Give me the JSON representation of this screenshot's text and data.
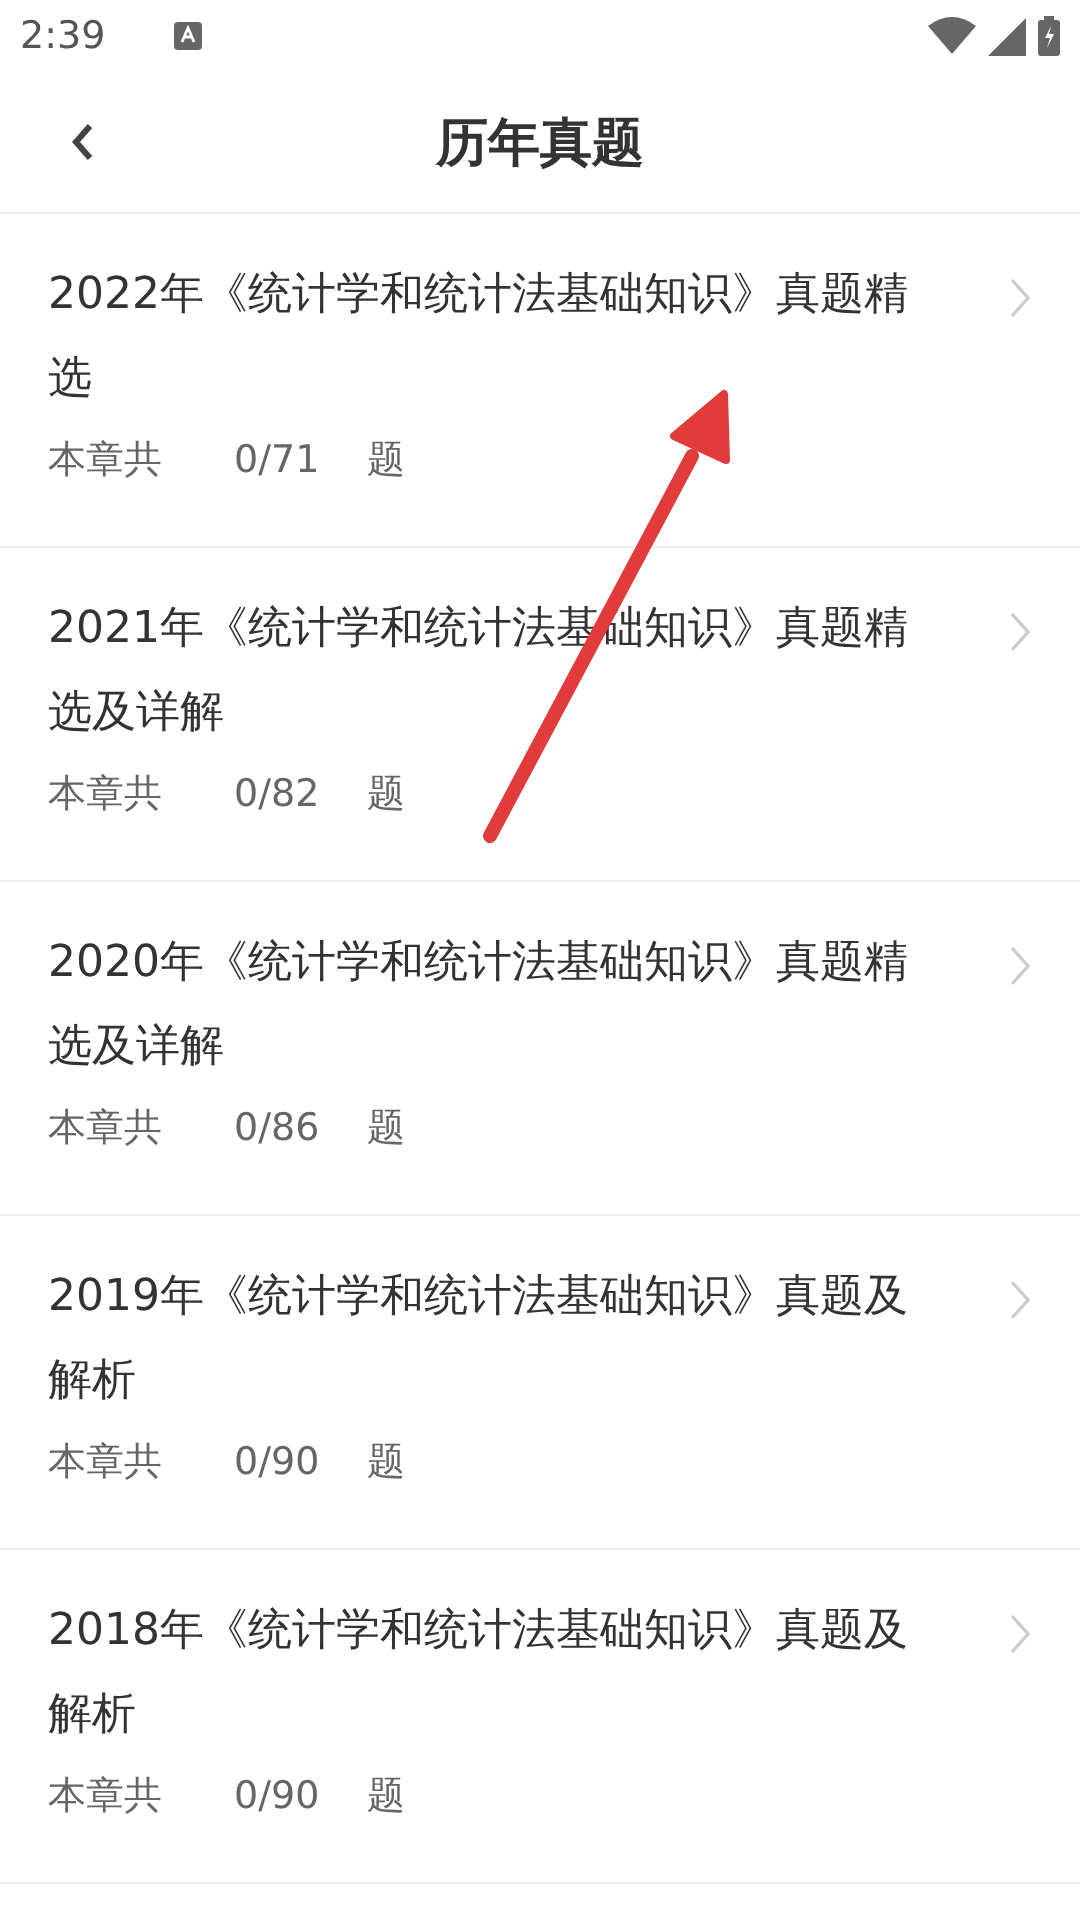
{
  "status_bar": {
    "time": "2:39"
  },
  "header": {
    "title": "历年真题"
  },
  "items": [
    {
      "title": "2022年《统计学和统计法基础知识》真题精选",
      "label": "本章共",
      "progress": "0/71",
      "unit": "题"
    },
    {
      "title": "2021年《统计学和统计法基础知识》真题精选及详解",
      "label": "本章共",
      "progress": "0/82",
      "unit": "题"
    },
    {
      "title": "2020年《统计学和统计法基础知识》真题精选及详解",
      "label": "本章共",
      "progress": "0/86",
      "unit": "题"
    },
    {
      "title": "2019年《统计学和统计法基础知识》真题及解析",
      "label": "本章共",
      "progress": "0/90",
      "unit": "题"
    },
    {
      "title": "2018年《统计学和统计法基础知识》真题及解析",
      "label": "本章共",
      "progress": "0/90",
      "unit": "题"
    }
  ]
}
